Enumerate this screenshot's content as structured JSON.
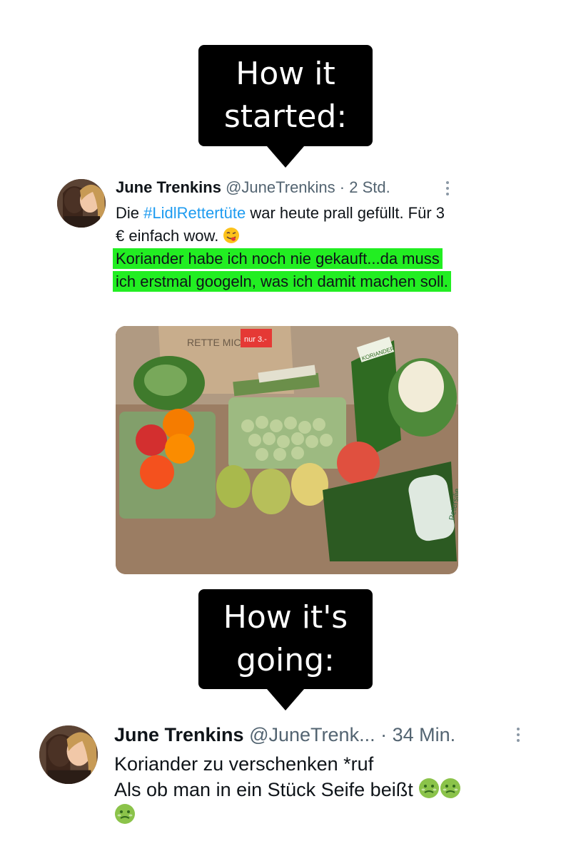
{
  "bubbles": {
    "first": {
      "line1": "How it",
      "line2": "started:"
    },
    "second": {
      "line1": "How it's",
      "line2": "going:"
    }
  },
  "tweet1": {
    "name": "June Trenkins",
    "handle": "@JuneTrenkins",
    "separator": "·",
    "time": "2 Std.",
    "text_before_tag": "Die ",
    "hashtag": "#LidlRettertüte",
    "text_after_tag": " war heute prall gefüllt. Für 3 € einfach wow.",
    "emoji": "face-savoring-food-icon",
    "highlighted_text": "Koriander habe ich noch nie gekauft...da muss ich erstmal googeln, was ich damit machen soll.",
    "highlight_color": "#22ee22",
    "photo": {
      "bag_text": "RETTE MICH",
      "price_tag": "nur 3.-",
      "label_koriander": "KORIANDER",
      "label_petersilie": "Petersilie"
    }
  },
  "tweet2": {
    "name": "June Trenkins",
    "handle": "@JuneTrenk...",
    "separator": "·",
    "time": "34 Min.",
    "line1": "Koriander zu verschenken *ruf",
    "line2": "Als ob man in ein Stück Seife beißt",
    "emoji": "nauseated-face-icon",
    "emoji_count": 3
  },
  "colors": {
    "hashtag": "#1d9bf0",
    "secondary_text": "#536471",
    "bubble": "#000000"
  }
}
